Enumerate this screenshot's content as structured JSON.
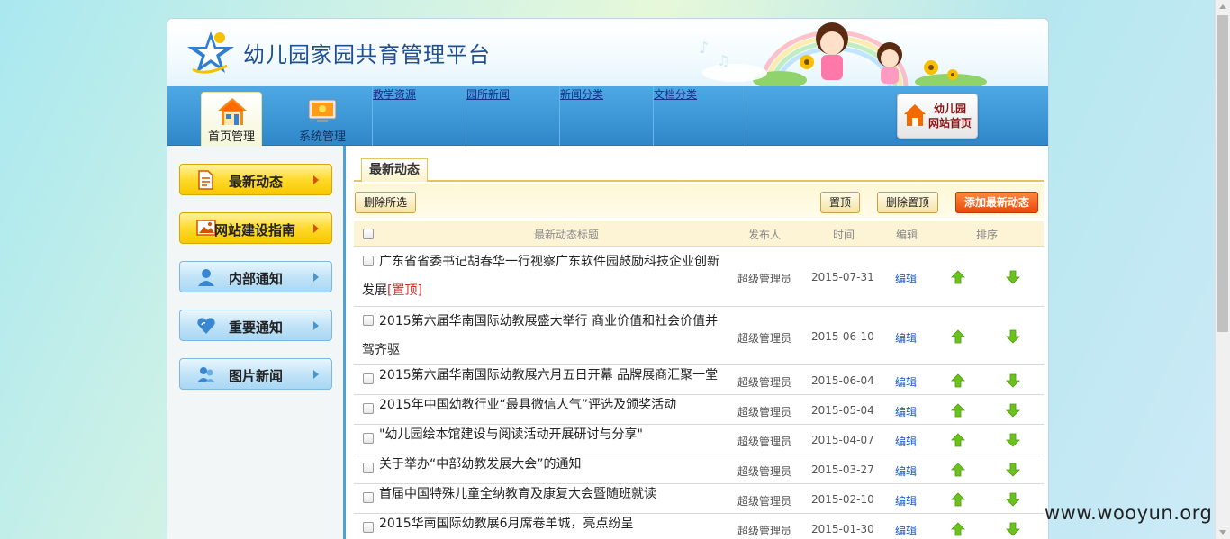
{
  "header": {
    "title": "幼儿园家园共育管理平台"
  },
  "nav": {
    "main": [
      {
        "label": "首页管理",
        "active": true,
        "icon": "house-icon"
      },
      {
        "label": "系统管理",
        "active": false,
        "icon": "monitor-icon"
      }
    ],
    "sub": [
      "教学资源",
      "园所新闻",
      "新闻分类",
      "文档分类"
    ],
    "home_button": {
      "line1": "幼儿园",
      "line2": "网站首页"
    }
  },
  "sidebar": {
    "items": [
      {
        "label": "最新动态",
        "style": "yellow",
        "icon": "document-icon"
      },
      {
        "label": "网站建设指南",
        "style": "yellow",
        "icon": "picture-icon"
      },
      {
        "label": "内部通知",
        "style": "blue",
        "icon": "user-icon"
      },
      {
        "label": "重要通知",
        "style": "blue",
        "icon": "heart-icon"
      },
      {
        "label": "图片新闻",
        "style": "blue",
        "icon": "users-icon"
      }
    ]
  },
  "content": {
    "tab": "最新动态",
    "toolbar": {
      "delete_selected": "删除所选",
      "pin": "置顶",
      "delete_pin": "删除置顶",
      "add": "添加最新动态"
    },
    "columns": {
      "title": "最新动态标题",
      "publisher": "发布人",
      "time": "时间",
      "edit": "编辑",
      "order": "排序"
    },
    "rows": [
      {
        "title": "广东省省委书记胡春华一行视察广东软件园鼓励科技企业创新发展",
        "pinned_tag": "[置顶]",
        "publisher": "超级管理员",
        "date": "2015-07-31",
        "edit": "编辑"
      },
      {
        "title": "2015第六届华南国际幼教展盛大举行 商业价值和社会价值并驾齐驱",
        "pinned_tag": "",
        "publisher": "超级管理员",
        "date": "2015-06-10",
        "edit": "编辑"
      },
      {
        "title": "2015第六届华南国际幼教展六月五日开幕 品牌展商汇聚一堂",
        "pinned_tag": "",
        "publisher": "超级管理员",
        "date": "2015-06-04",
        "edit": "编辑"
      },
      {
        "title": "2015年中国幼教行业“最具微信人气”评选及颁奖活动",
        "pinned_tag": "",
        "publisher": "超级管理员",
        "date": "2015-05-04",
        "edit": "编辑"
      },
      {
        "title": "\"幼儿园绘本馆建设与阅读活动开展研讨与分享\"",
        "pinned_tag": "",
        "publisher": "超级管理员",
        "date": "2015-04-07",
        "edit": "编辑"
      },
      {
        "title": "关于举办“中部幼教发展大会”的通知",
        "pinned_tag": "",
        "publisher": "超级管理员",
        "date": "2015-03-27",
        "edit": "编辑"
      },
      {
        "title": "首届中国特殊儿童全纳教育及康复大会暨随班就读",
        "pinned_tag": "",
        "publisher": "超级管理员",
        "date": "2015-02-10",
        "edit": "编辑"
      },
      {
        "title": "2015华南国际幼教展6月席卷羊城，亮点纷呈",
        "pinned_tag": "",
        "publisher": "超级管理员",
        "date": "2015-01-30",
        "edit": "编辑"
      }
    ]
  },
  "watermark": "www.wooyun.org",
  "colors": {
    "nav_blue": "#3d97d6",
    "accent_orange": "#e8490a",
    "link_blue": "#1a58c9",
    "pin_red": "#d42a2a",
    "arrow_green": "#6cc21c"
  }
}
